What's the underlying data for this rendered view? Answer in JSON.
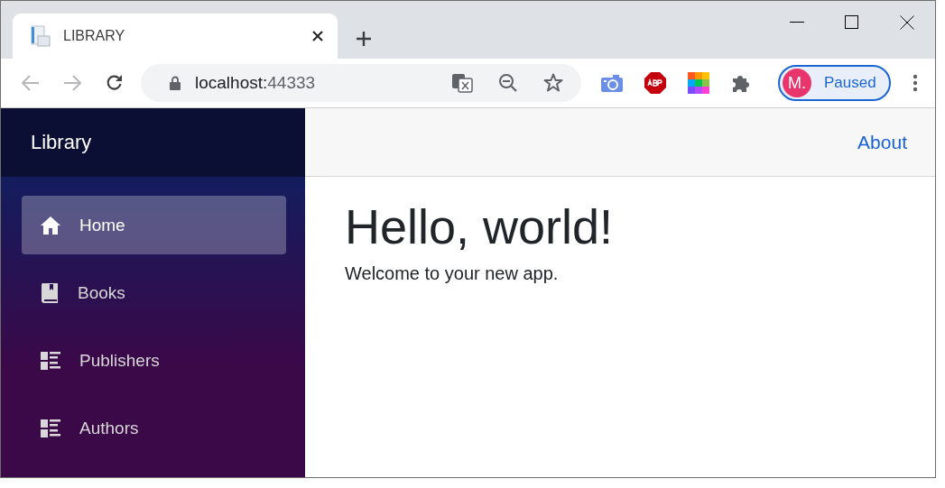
{
  "browser": {
    "tab": {
      "title": "LIBRARY",
      "selected": true
    },
    "address": {
      "host": "localhost:",
      "port": "44333"
    },
    "profile": {
      "initial": "M.",
      "status": "Paused"
    }
  },
  "sidebar": {
    "brand": "Library",
    "items": [
      {
        "label": "Home",
        "kind": "home",
        "selected": true
      },
      {
        "label": "Books",
        "kind": "book",
        "selected": false
      },
      {
        "label": "Publishers",
        "kind": "list",
        "selected": false
      },
      {
        "label": "Authors",
        "kind": "list",
        "selected": false
      }
    ]
  },
  "topbar": {
    "link": "About"
  },
  "content": {
    "heading": "Hello, world!",
    "text": "Welcome to your new app."
  }
}
